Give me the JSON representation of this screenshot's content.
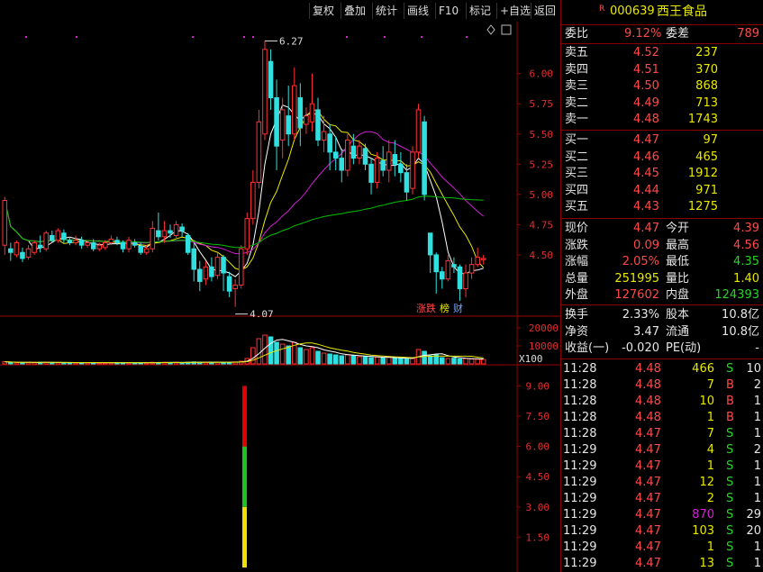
{
  "toolbar": {
    "buttons": [
      "复权",
      "叠加",
      "统计",
      "画线",
      "F10",
      "标记",
      "+自选",
      "返回"
    ]
  },
  "stock": {
    "badge": "R",
    "code": "000639",
    "name": "西王食品"
  },
  "weibi": {
    "label1": "委比",
    "value1": "9.12%",
    "label2": "委差",
    "value2": "789"
  },
  "orderbook": {
    "sells": [
      {
        "label": "卖五",
        "price": "4.52",
        "vol": "237"
      },
      {
        "label": "卖四",
        "price": "4.51",
        "vol": "370"
      },
      {
        "label": "卖三",
        "price": "4.50",
        "vol": "868"
      },
      {
        "label": "卖二",
        "price": "4.49",
        "vol": "713"
      },
      {
        "label": "卖一",
        "price": "4.48",
        "vol": "1743"
      }
    ],
    "buys": [
      {
        "label": "买一",
        "price": "4.47",
        "vol": "97"
      },
      {
        "label": "买二",
        "price": "4.46",
        "vol": "465"
      },
      {
        "label": "买三",
        "price": "4.45",
        "vol": "1912"
      },
      {
        "label": "买四",
        "price": "4.44",
        "vol": "971"
      },
      {
        "label": "买五",
        "price": "4.43",
        "vol": "1275"
      }
    ]
  },
  "quote": [
    {
      "l1": "现价",
      "v1": "4.47",
      "c1": "red",
      "l2": "今开",
      "v2": "4.39",
      "c2": "red"
    },
    {
      "l1": "涨跌",
      "v1": "0.09",
      "c1": "red",
      "l2": "最高",
      "v2": "4.56",
      "c2": "red"
    },
    {
      "l1": "涨幅",
      "v1": "2.05%",
      "c1": "red",
      "l2": "最低",
      "v2": "4.35",
      "c2": "green"
    },
    {
      "l1": "总量",
      "v1": "251995",
      "c1": "yellow",
      "l2": "量比",
      "v2": "1.40",
      "c2": "yellow"
    },
    {
      "l1": "外盘",
      "v1": "127602",
      "c1": "red",
      "l2": "内盘",
      "v2": "124393",
      "c2": "green"
    }
  ],
  "stats": [
    {
      "l1": "换手",
      "v1": "2.33%",
      "l2": "股本",
      "v2": "10.8亿"
    },
    {
      "l1": "净资",
      "v1": "3.47",
      "l2": "流通",
      "v2": "10.8亿"
    },
    {
      "l1": "收益(一)",
      "v1": "-0.020",
      "l2": "PE(动)",
      "v2": "-"
    }
  ],
  "ticks": [
    {
      "time": "11:28",
      "price": "4.48",
      "vol": "466",
      "vcolor": "yellow",
      "side": "S",
      "cnt": "10"
    },
    {
      "time": "11:28",
      "price": "4.48",
      "vol": "7",
      "vcolor": "yellow",
      "side": "B",
      "cnt": "2"
    },
    {
      "time": "11:28",
      "price": "4.48",
      "vol": "10",
      "vcolor": "yellow",
      "side": "B",
      "cnt": "1"
    },
    {
      "time": "11:28",
      "price": "4.48",
      "vol": "1",
      "vcolor": "yellow",
      "side": "B",
      "cnt": "1"
    },
    {
      "time": "11:28",
      "price": "4.47",
      "vol": "7",
      "vcolor": "yellow",
      "side": "S",
      "cnt": "1"
    },
    {
      "time": "11:29",
      "price": "4.47",
      "vol": "4",
      "vcolor": "yellow",
      "side": "S",
      "cnt": "2"
    },
    {
      "time": "11:29",
      "price": "4.47",
      "vol": "1",
      "vcolor": "yellow",
      "side": "S",
      "cnt": "1"
    },
    {
      "time": "11:29",
      "price": "4.47",
      "vol": "12",
      "vcolor": "yellow",
      "side": "S",
      "cnt": "1"
    },
    {
      "time": "11:29",
      "price": "4.47",
      "vol": "2",
      "vcolor": "yellow",
      "side": "S",
      "cnt": "1"
    },
    {
      "time": "11:29",
      "price": "4.47",
      "vol": "870",
      "vcolor": "purple",
      "side": "S",
      "cnt": "29"
    },
    {
      "time": "11:29",
      "price": "4.47",
      "vol": "103",
      "vcolor": "yellow",
      "side": "S",
      "cnt": "20"
    },
    {
      "time": "11:29",
      "price": "4.47",
      "vol": "1",
      "vcolor": "yellow",
      "side": "S",
      "cnt": "1"
    },
    {
      "time": "11:29",
      "price": "4.47",
      "vol": "13",
      "vcolor": "yellow",
      "side": "S",
      "cnt": "1"
    }
  ],
  "chart_badges": [
    "涨跌",
    "榜",
    "财"
  ],
  "chart_data": [
    {
      "type": "candlestick",
      "y_ticks": [
        "6.00",
        "5.75",
        "5.50",
        "5.25",
        "5.00",
        "4.75",
        "4.50"
      ],
      "ylim": [
        4.0,
        6.4
      ],
      "annotations": [
        {
          "label": "6.27",
          "value": 6.27
        },
        {
          "label": "4.07",
          "value": 4.07
        }
      ],
      "colors": {
        "up": "#ff3232",
        "down": "#30e0e0",
        "ma1": "#ffffff",
        "ma2": "#e8e800",
        "ma3": "#d020d0",
        "ma4": "#00c000"
      },
      "candles": [
        [
          4.58,
          4.95,
          4.5,
          4.98
        ],
        [
          4.55,
          4.52,
          4.45,
          4.6
        ],
        [
          4.5,
          4.6,
          4.48,
          4.62
        ],
        [
          4.52,
          4.47,
          4.44,
          4.56
        ],
        [
          4.48,
          4.55,
          4.46,
          4.58
        ],
        [
          4.52,
          4.6,
          4.5,
          4.62
        ],
        [
          4.58,
          4.56,
          4.52,
          4.66
        ],
        [
          4.55,
          4.68,
          4.53,
          4.7
        ],
        [
          4.66,
          4.62,
          4.6,
          4.7
        ],
        [
          4.62,
          4.7,
          4.6,
          4.72
        ],
        [
          4.68,
          4.63,
          4.6,
          4.71
        ],
        [
          4.62,
          4.6,
          4.58,
          4.65
        ],
        [
          4.6,
          4.62,
          4.58,
          4.66
        ],
        [
          4.62,
          4.58,
          4.55,
          4.65
        ],
        [
          4.58,
          4.6,
          4.56,
          4.62
        ],
        [
          4.6,
          4.55,
          4.53,
          4.63
        ],
        [
          4.55,
          4.58,
          4.53,
          4.6
        ],
        [
          4.56,
          4.6,
          4.54,
          4.62
        ],
        [
          4.6,
          4.63,
          4.58,
          4.66
        ],
        [
          4.62,
          4.6,
          4.58,
          4.65
        ],
        [
          4.6,
          4.55,
          4.52,
          4.62
        ],
        [
          4.55,
          4.62,
          4.52,
          4.65
        ],
        [
          4.6,
          4.58,
          4.56,
          4.63
        ],
        [
          4.57,
          4.52,
          4.5,
          4.6
        ],
        [
          4.52,
          4.55,
          4.5,
          4.58
        ],
        [
          4.55,
          4.72,
          4.52,
          4.78
        ],
        [
          4.7,
          4.65,
          4.62,
          4.85
        ],
        [
          4.65,
          4.7,
          4.6,
          4.78
        ],
        [
          4.7,
          4.68,
          4.64,
          4.75
        ],
        [
          4.66,
          4.75,
          4.63,
          4.78
        ],
        [
          4.73,
          4.7,
          4.65,
          4.76
        ],
        [
          4.66,
          4.52,
          4.5,
          4.68
        ],
        [
          4.55,
          4.38,
          4.28,
          4.6
        ],
        [
          4.38,
          4.28,
          4.2,
          4.45
        ],
        [
          4.3,
          4.4,
          4.25,
          4.45
        ],
        [
          4.4,
          4.32,
          4.28,
          4.48
        ],
        [
          4.33,
          4.48,
          4.3,
          4.52
        ],
        [
          4.48,
          4.35,
          4.2,
          4.5
        ],
        [
          4.32,
          4.2,
          4.15,
          4.36
        ],
        [
          4.22,
          4.25,
          4.07,
          4.3
        ],
        [
          4.25,
          4.55,
          4.22,
          4.58
        ],
        [
          4.55,
          4.8,
          4.5,
          4.85
        ],
        [
          4.8,
          5.1,
          4.75,
          5.2
        ],
        [
          5.1,
          5.6,
          5.05,
          5.7
        ],
        [
          5.5,
          6.2,
          5.45,
          6.27
        ],
        [
          6.1,
          5.8,
          5.7,
          6.2
        ],
        [
          5.8,
          5.4,
          5.2,
          5.95
        ],
        [
          5.45,
          5.7,
          5.3,
          5.8
        ],
        [
          5.65,
          5.5,
          5.4,
          5.9
        ],
        [
          5.5,
          5.9,
          5.45,
          6.05
        ],
        [
          5.8,
          5.55,
          5.4,
          5.92
        ],
        [
          5.58,
          5.65,
          5.5,
          5.72
        ],
        [
          5.6,
          5.75,
          5.52,
          6.0
        ],
        [
          5.7,
          5.45,
          5.4,
          5.8
        ],
        [
          5.45,
          5.52,
          5.35,
          5.65
        ],
        [
          5.5,
          5.35,
          5.2,
          5.58
        ],
        [
          5.35,
          5.3,
          5.2,
          5.48
        ],
        [
          5.3,
          5.2,
          5.1,
          5.38
        ],
        [
          5.2,
          5.45,
          5.15,
          5.5
        ],
        [
          5.4,
          5.3,
          5.25,
          5.5
        ],
        [
          5.3,
          5.4,
          5.25,
          5.45
        ],
        [
          5.38,
          5.25,
          5.2,
          5.42
        ],
        [
          5.25,
          5.1,
          5.0,
          5.3
        ],
        [
          5.1,
          5.3,
          5.05,
          5.35
        ],
        [
          5.28,
          5.2,
          5.15,
          5.4
        ],
        [
          5.2,
          5.35,
          5.1,
          5.45
        ],
        [
          5.33,
          5.25,
          5.15,
          5.45
        ],
        [
          5.25,
          5.18,
          5.1,
          5.35
        ],
        [
          5.18,
          5.02,
          4.95,
          5.25
        ],
        [
          5.05,
          5.35,
          5.0,
          5.4
        ],
        [
          5.35,
          5.7,
          5.3,
          5.75
        ],
        [
          5.6,
          5.0,
          4.95,
          5.65
        ],
        [
          4.68,
          4.5,
          4.35,
          4.68
        ],
        [
          4.5,
          4.36,
          4.18,
          4.52
        ],
        [
          4.36,
          4.3,
          4.22,
          4.4
        ],
        [
          4.3,
          4.45,
          4.28,
          4.5
        ],
        [
          4.42,
          4.4,
          4.35,
          4.48
        ],
        [
          4.4,
          4.22,
          4.12,
          4.42
        ],
        [
          4.22,
          4.35,
          4.15,
          4.42
        ],
        [
          4.35,
          4.42,
          4.3,
          4.48
        ],
        [
          4.42,
          4.48,
          4.4,
          4.56
        ],
        [
          4.46,
          4.47,
          4.42,
          4.5
        ]
      ]
    },
    {
      "type": "bar",
      "y_ticks": [
        "20000",
        "10000"
      ],
      "unit_label": "X100",
      "ylim": [
        0,
        24000
      ],
      "values": [
        1200,
        900,
        800,
        700,
        900,
        800,
        900,
        850,
        700,
        800,
        700,
        650,
        700,
        650,
        700,
        700,
        650,
        700,
        700,
        650,
        700,
        650,
        700,
        650,
        700,
        900,
        800,
        850,
        800,
        850,
        800,
        900,
        1100,
        1000,
        950,
        900,
        950,
        1000,
        1000,
        1100,
        1500,
        3000,
        9000,
        14000,
        16000,
        15000,
        12000,
        11000,
        10000,
        12000,
        9000,
        8000,
        9000,
        7000,
        6000,
        5500,
        5000,
        4500,
        5000,
        4500,
        4000,
        4000,
        3500,
        3800,
        3500,
        3600,
        3200,
        3000,
        2800,
        3000,
        8000,
        7000,
        4500,
        5000,
        3500,
        3000,
        3200,
        2800,
        3000,
        2700,
        2600,
        2500
      ]
    },
    {
      "type": "bar",
      "y_ticks": [
        "9.00",
        "7.50",
        "6.00",
        "4.50",
        "3.00",
        "1.50"
      ],
      "ylim": [
        0,
        10
      ],
      "segments": [
        {
          "from": 0,
          "to": 3.0,
          "color": "#f0e000"
        },
        {
          "from": 3.0,
          "to": 6.0,
          "color": "#20c020"
        },
        {
          "from": 6.0,
          "to": 9.0,
          "color": "#e00000"
        }
      ]
    }
  ]
}
